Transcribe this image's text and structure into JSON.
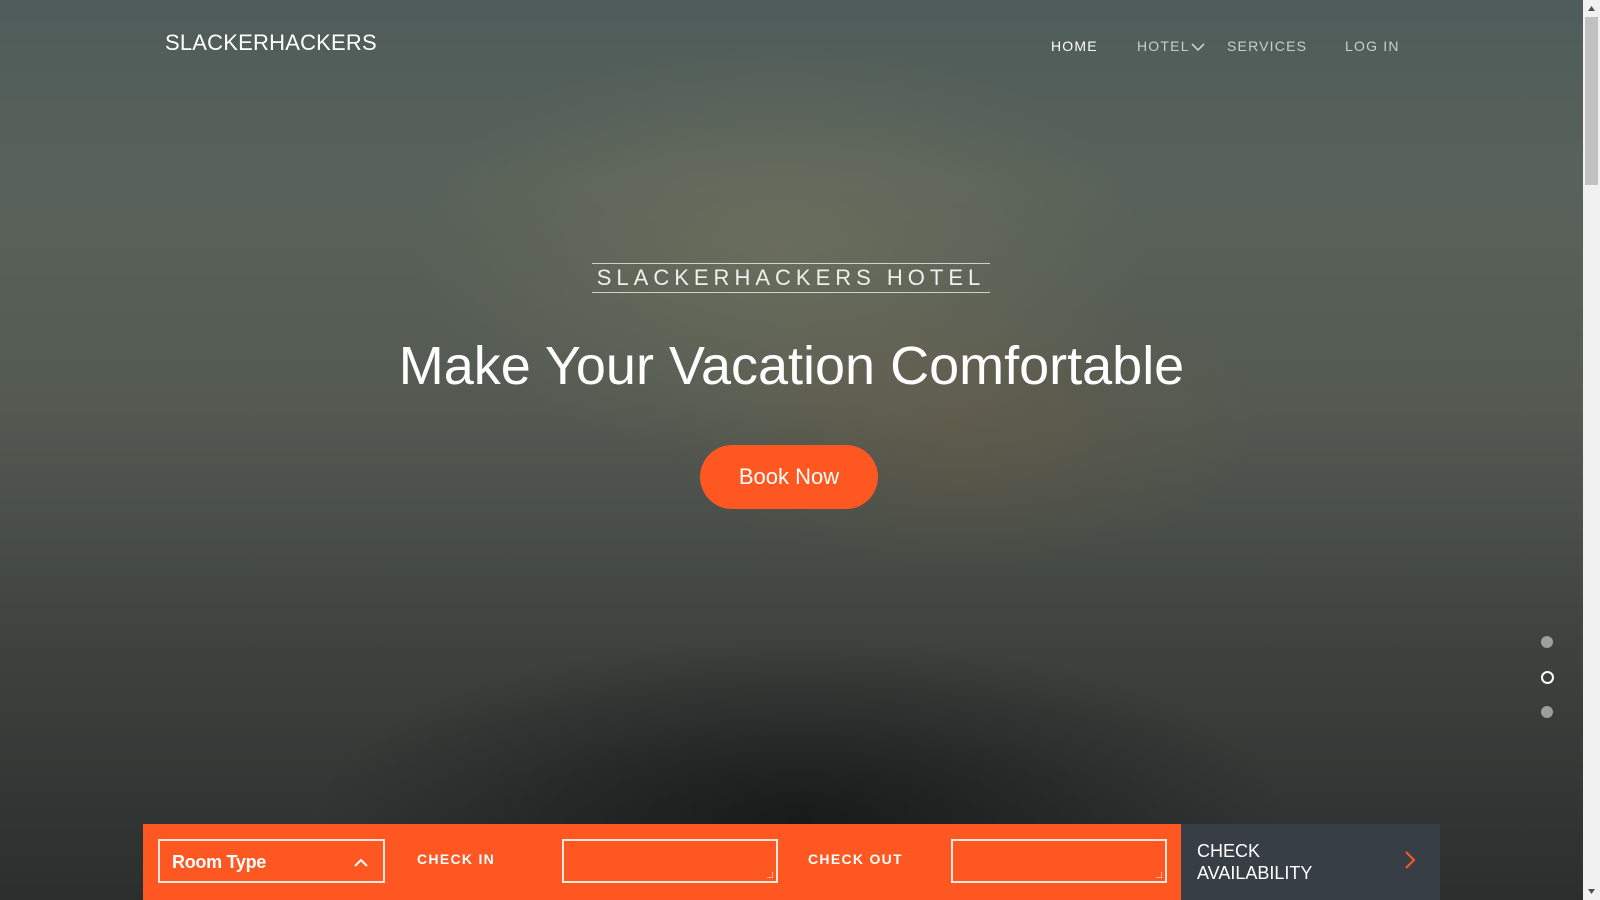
{
  "brand": {
    "logo": "SLACKERHACKERS"
  },
  "nav": {
    "items": [
      {
        "label": "HOME"
      },
      {
        "label": "HOTEL"
      },
      {
        "label": "SERVICES"
      },
      {
        "label": "LOG IN"
      }
    ]
  },
  "hero": {
    "eyebrow": "SLACKERHACKERS HOTEL",
    "headline": "Make Your Vacation Comfortable",
    "cta": "Book Now"
  },
  "booking": {
    "room_type": "Room Type",
    "check_in_label": "CHECK IN",
    "check_in_value": "",
    "check_out_label": "CHECK OUT",
    "check_out_value": "",
    "submit": "CHECK AVAILABILITY"
  },
  "colors": {
    "accent": "#ff5722",
    "submit_bg": "#383e46"
  }
}
